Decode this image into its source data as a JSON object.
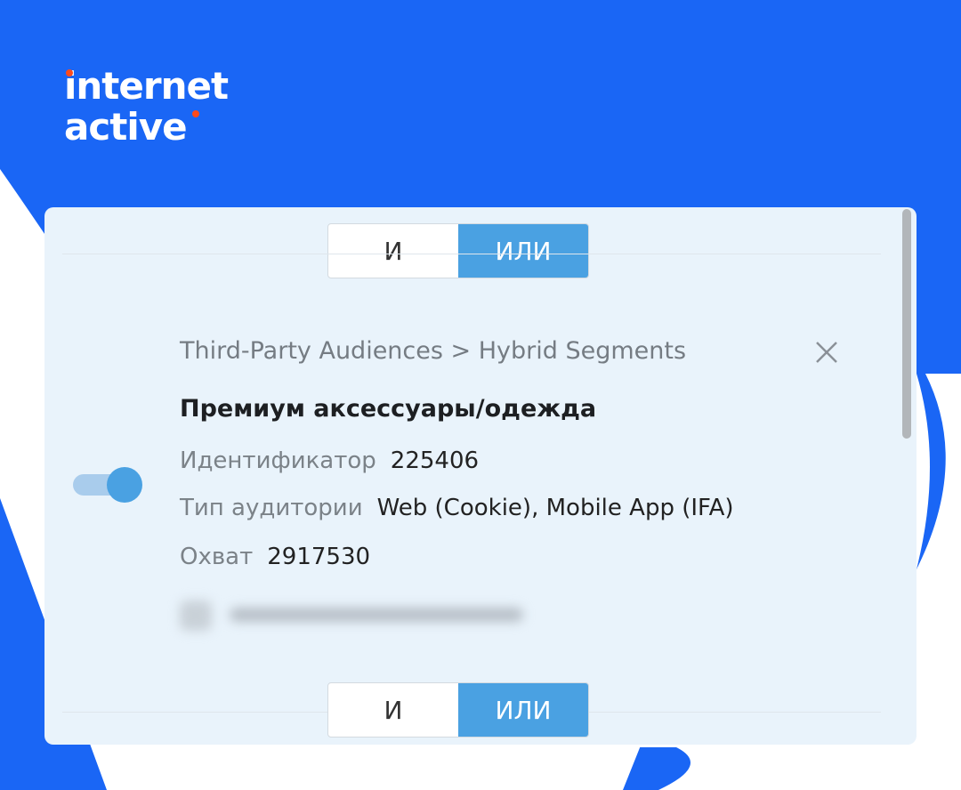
{
  "brand": {
    "logo_line1": "internet",
    "logo_line2": "active",
    "background": "#1a66f5",
    "accent": "#ff4a1c"
  },
  "panel": {
    "top_toggle": {
      "and_label": "И",
      "or_label": "ИЛИ",
      "selected": "ИЛИ"
    },
    "segment": {
      "breadcrumb": "Third-Party Audiences > Hybrid Segments",
      "title": "Премиум аксессуары/одежда",
      "id_label": "Идентификатор",
      "id_value": "225406",
      "type_label": "Тип аудитории",
      "type_value": "Web (Cookie), Mobile App (IFA)",
      "reach_label": "Охват",
      "reach_value": "2917530",
      "enabled": true
    },
    "bottom_toggle": {
      "and_label": "И",
      "or_label": "ИЛИ",
      "selected": "ИЛИ"
    },
    "toggle_active_color": "#4aa1e2"
  }
}
